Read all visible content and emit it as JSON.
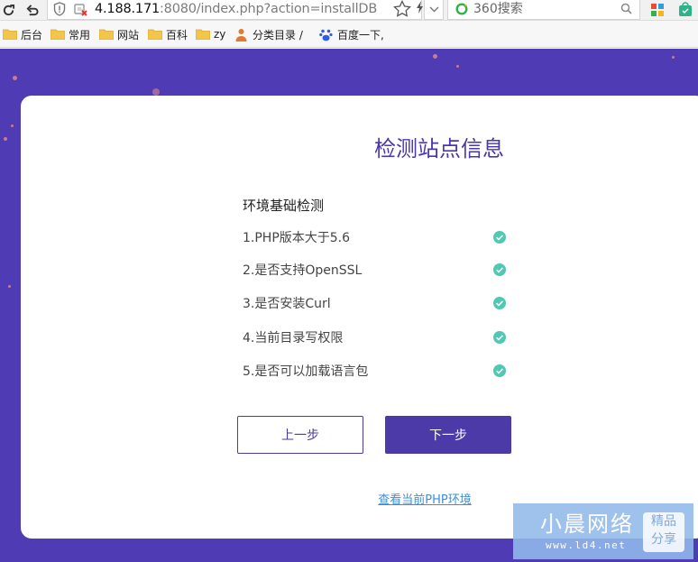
{
  "browser": {
    "url_host": "4.188.171",
    "url_rest": ":8080/index.php?action=installDB",
    "search_placeholder": "360搜索",
    "bookmarks": [
      "后台",
      "常用",
      "网站",
      "百科",
      "zy",
      "分类目录 /",
      "百度一下,"
    ]
  },
  "page": {
    "title": "检测站点信息",
    "section_title": "环境基础检测",
    "checks": [
      {
        "label": "1.PHP版本大于5.6",
        "passed": true
      },
      {
        "label": "2.是否支持OpenSSL",
        "passed": true
      },
      {
        "label": "3.是否安装Curl",
        "passed": true
      },
      {
        "label": "4.当前目录写权限",
        "passed": true
      },
      {
        "label": "5.是否可以加载语言包",
        "passed": true
      }
    ],
    "prev_label": "上一步",
    "next_label": "下一步",
    "php_link_label": "查看当前PHP环境"
  },
  "watermark": {
    "title": "小晨网络",
    "url": "www.ld4.net",
    "badge_line1": "精品",
    "badge_line2": "分享"
  },
  "colors": {
    "accent": "#4b3aa8",
    "page_bg": "#4f3cb4",
    "check": "#4fc8b4",
    "link": "#3b8fd9"
  }
}
